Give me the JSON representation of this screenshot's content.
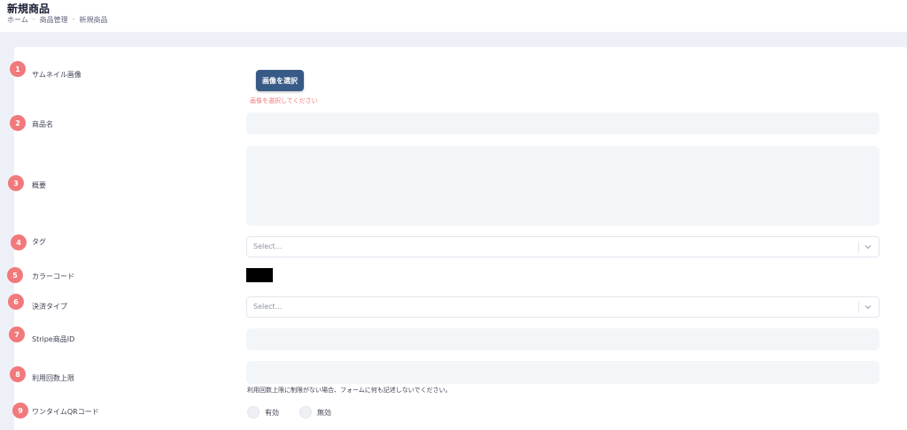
{
  "page": {
    "title": "新規商品",
    "breadcrumb": [
      "ホーム",
      "商品管理",
      "新規商品"
    ],
    "breadcrumb_sep": "-"
  },
  "colors": {
    "badge": "#f1797c",
    "primary_button": "#375a86",
    "input_bg": "#f3f6f9",
    "color_swatch": "#000000"
  },
  "form": {
    "thumbnail": {
      "num": "1",
      "label": "サムネイル画像",
      "button": "画像を選択",
      "error": "画像を選択してください"
    },
    "name": {
      "num": "2",
      "label": "商品名",
      "value": ""
    },
    "summary": {
      "num": "3",
      "label": "概要",
      "value": ""
    },
    "tags": {
      "num": "4",
      "label": "タグ",
      "placeholder": "Select..."
    },
    "color_code": {
      "num": "5",
      "label": "カラーコード",
      "value": "#000000"
    },
    "payment_type": {
      "num": "6",
      "label": "決済タイプ",
      "placeholder": "Select..."
    },
    "stripe_id": {
      "num": "7",
      "label": "Stripe商品ID",
      "value": ""
    },
    "usage_limit": {
      "num": "8",
      "label": "利用回数上限",
      "value": "",
      "hint": "利用回数上限に制限がない場合、フォームに何も記述しないでください。"
    },
    "onetime_qr": {
      "num": "9",
      "label": "ワンタイムQRコード",
      "options": [
        "有効",
        "無効"
      ]
    }
  },
  "icons": {
    "dropdown": "chevron-down-icon"
  }
}
